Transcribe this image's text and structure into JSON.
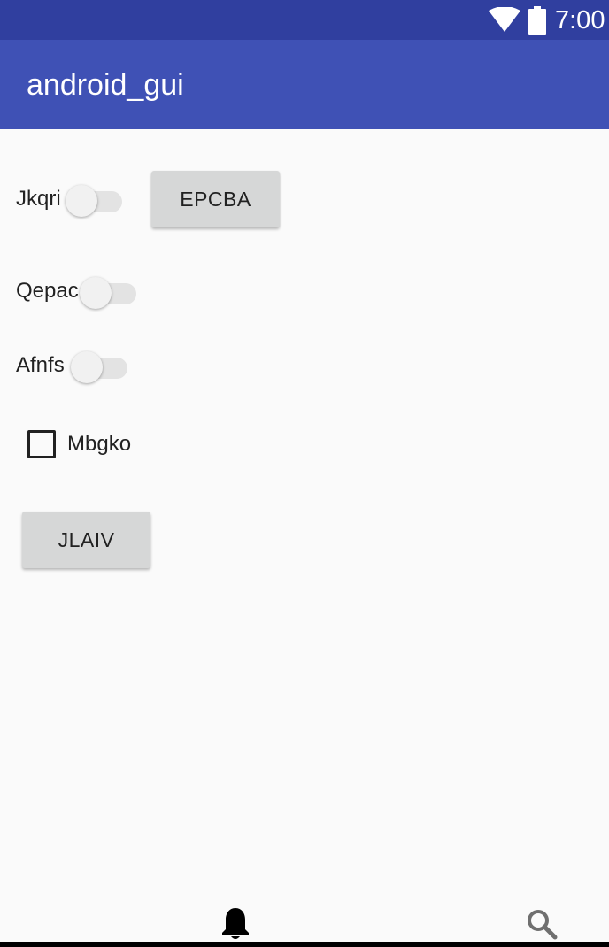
{
  "status_bar": {
    "time": "7:00",
    "icons": [
      "wifi-icon",
      "battery-icon"
    ]
  },
  "app_bar": {
    "title": "android_gui",
    "background": "#3f51b5",
    "status_background": "#303f9f"
  },
  "form": {
    "switches": [
      {
        "label": "Jkqri",
        "checked": false
      },
      {
        "label": "Qepac",
        "checked": false
      },
      {
        "label": "Afnfs",
        "checked": false
      }
    ],
    "buttons": {
      "epcba": "EPCBA",
      "jlaiv": "JLAIV"
    },
    "checkbox": {
      "label": "Mbgko",
      "checked": false
    }
  },
  "bottom_bar": {
    "icons": [
      "bell-icon",
      "search-icon"
    ]
  }
}
